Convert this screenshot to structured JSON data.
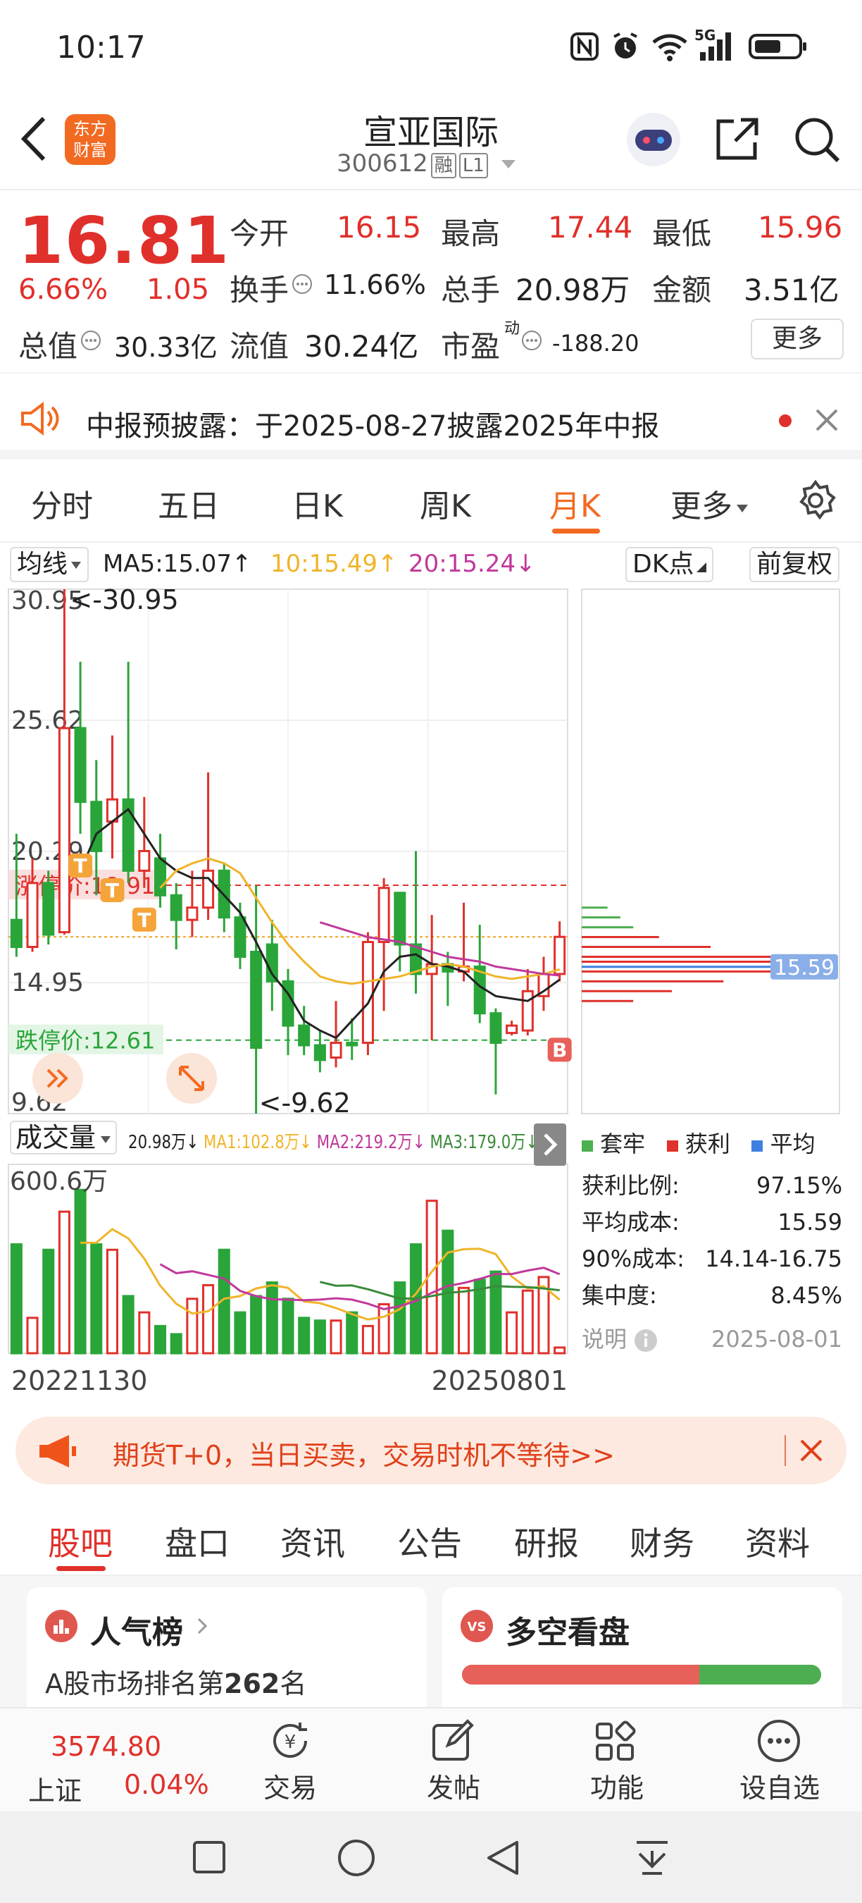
{
  "status_bar": {
    "time": "10:17",
    "network": "5G"
  },
  "header": {
    "title": "宣亚国际",
    "code": "300612",
    "tag_rong": "融",
    "tag_level": "L1",
    "logo_text": "东方\n财富",
    "icons": [
      "back-icon",
      "robot-icon",
      "share-icon",
      "search-icon"
    ]
  },
  "quote": {
    "price": "16.81",
    "change_pct": "6.66%",
    "change": "1.05",
    "open_label": "今开",
    "open": "16.15",
    "high_label": "最高",
    "high": "17.44",
    "low_label": "最低",
    "low": "15.96",
    "turnover_label": "换手",
    "turnover": "11.66%",
    "volume_label": "总手",
    "volume": "20.98万",
    "amount_label": "金额",
    "amount": "3.51亿",
    "mktcap_label": "总值",
    "mktcap": "30.33亿",
    "float_label": "流值",
    "float": "30.24亿",
    "pe_label": "市盈",
    "pe_sup": "动",
    "pe": "-188.20",
    "more_label": "更多"
  },
  "notice": {
    "text": "中报预披露：于2025-08-27披露2025年中报"
  },
  "tabs": {
    "items": [
      "分时",
      "五日",
      "日K",
      "周K",
      "月K",
      "更多"
    ],
    "active": "月K"
  },
  "ma_bar": {
    "select_label": "均线",
    "ma5": "MA5:15.07",
    "ma10": "10:15.49",
    "ma20": "20:15.24",
    "dk_label": "DK点",
    "adjust_label": "前复权"
  },
  "chart_data": {
    "type": "candlestick",
    "period": "monthly",
    "y_axis_labels": [
      "30.95",
      "25.62",
      "20.29",
      "14.95",
      "9.62"
    ],
    "ylim": [
      9.62,
      30.95
    ],
    "max_annotation": "<-30.95",
    "min_annotation": "<-9.62",
    "limit_up": {
      "label": "涨停价:18.91",
      "value": 18.91
    },
    "limit_down": {
      "label": "跌停价:12.61",
      "value": 12.61
    },
    "current_price_line": 16.81,
    "markers": [
      "T",
      "T",
      "T",
      "B"
    ],
    "candles": [
      {
        "o": 17.5,
        "c": 16.4,
        "h": 21.0,
        "l": 16.0
      },
      {
        "o": 16.4,
        "c": 19.0,
        "h": 20.0,
        "l": 16.2
      },
      {
        "o": 19.0,
        "c": 16.9,
        "h": 19.5,
        "l": 16.5
      },
      {
        "o": 17.0,
        "c": 25.3,
        "h": 30.95,
        "l": 16.9
      },
      {
        "o": 25.3,
        "c": 22.3,
        "h": 28.0,
        "l": 21.0
      },
      {
        "o": 22.3,
        "c": 20.3,
        "h": 24.0,
        "l": 18.5
      },
      {
        "o": 21.5,
        "c": 22.4,
        "h": 25.0,
        "l": 20.0
      },
      {
        "o": 22.4,
        "c": 19.5,
        "h": 28.0,
        "l": 19.0
      },
      {
        "o": 19.5,
        "c": 20.3,
        "h": 22.5,
        "l": 18.8
      },
      {
        "o": 20.0,
        "c": 18.5,
        "h": 21.0,
        "l": 18.0
      },
      {
        "o": 18.5,
        "c": 17.5,
        "h": 19.0,
        "l": 16.3
      },
      {
        "o": 17.5,
        "c": 18.0,
        "h": 19.5,
        "l": 16.8
      },
      {
        "o": 18.0,
        "c": 19.5,
        "h": 23.5,
        "l": 17.5
      },
      {
        "o": 19.5,
        "c": 17.6,
        "h": 19.8,
        "l": 17.0
      },
      {
        "o": 17.6,
        "c": 16.0,
        "h": 18.2,
        "l": 15.5
      },
      {
        "o": 16.2,
        "c": 12.3,
        "h": 18.9,
        "l": 9.62
      },
      {
        "o": 16.5,
        "c": 15.0,
        "h": 17.5,
        "l": 13.8
      },
      {
        "o": 15.0,
        "c": 13.2,
        "h": 15.5,
        "l": 12.0
      },
      {
        "o": 13.2,
        "c": 12.4,
        "h": 14.0,
        "l": 12.0
      },
      {
        "o": 12.4,
        "c": 11.8,
        "h": 13.0,
        "l": 11.3
      },
      {
        "o": 11.9,
        "c": 12.5,
        "h": 14.2,
        "l": 11.5
      },
      {
        "o": 12.5,
        "c": 12.4,
        "h": 13.5,
        "l": 11.8
      },
      {
        "o": 12.5,
        "c": 16.6,
        "h": 17.0,
        "l": 12.0
      },
      {
        "o": 16.6,
        "c": 18.8,
        "h": 19.2,
        "l": 13.8
      },
      {
        "o": 18.6,
        "c": 16.5,
        "h": 18.6,
        "l": 15.4
      },
      {
        "o": 16.5,
        "c": 15.3,
        "h": 20.3,
        "l": 14.5
      },
      {
        "o": 15.3,
        "c": 15.7,
        "h": 17.7,
        "l": 12.6
      },
      {
        "o": 15.7,
        "c": 15.4,
        "h": 16.2,
        "l": 14.0
      },
      {
        "o": 15.4,
        "c": 15.6,
        "h": 18.2,
        "l": 15.0
      },
      {
        "o": 15.6,
        "c": 13.7,
        "h": 17.3,
        "l": 13.3
      },
      {
        "o": 13.7,
        "c": 12.5,
        "h": 13.9,
        "l": 10.4
      },
      {
        "o": 12.9,
        "c": 13.2,
        "h": 13.4,
        "l": 12.8
      },
      {
        "o": 13.0,
        "c": 14.6,
        "h": 15.5,
        "l": 12.8
      },
      {
        "o": 14.4,
        "c": 15.3,
        "h": 16.0,
        "l": 13.8
      },
      {
        "o": 15.3,
        "c": 16.81,
        "h": 17.44,
        "l": 15.0
      }
    ],
    "ma_lines": [
      {
        "name": "MA5",
        "color": "#222222",
        "values": [
          null,
          null,
          null,
          null,
          19.5,
          21.0,
          21.5,
          22.0,
          21.0,
          20.0,
          19.5,
          19.2,
          19.2,
          18.5,
          17.8,
          16.6,
          15.3,
          14.5,
          13.4,
          13.0,
          12.7,
          13.4,
          14.1,
          15.4,
          16.0,
          16.1,
          15.7,
          15.6,
          15.4,
          14.8,
          14.4,
          14.3,
          14.2,
          14.6,
          15.07
        ]
      },
      {
        "name": "MA10",
        "color": "#f0b429",
        "values": [
          null,
          null,
          null,
          null,
          null,
          null,
          null,
          null,
          null,
          18.8,
          19.5,
          19.8,
          20.0,
          19.8,
          19.4,
          18.4,
          17.4,
          16.5,
          15.8,
          15.2,
          15.0,
          14.9,
          15.0,
          15.1,
          15.2,
          15.4,
          15.6,
          15.7,
          15.6,
          15.4,
          15.2,
          15.1,
          15.2,
          15.3,
          15.49
        ]
      },
      {
        "name": "MA20",
        "color": "#c0399a",
        "values": [
          null,
          null,
          null,
          null,
          null,
          null,
          null,
          null,
          null,
          null,
          null,
          null,
          null,
          null,
          null,
          null,
          null,
          null,
          null,
          17.4,
          17.2,
          17.0,
          16.8,
          16.7,
          16.6,
          16.4,
          16.2,
          16.0,
          15.9,
          15.8,
          15.6,
          15.5,
          15.4,
          15.3,
          15.24
        ]
      }
    ],
    "volume": {
      "label": "成交量",
      "current": "20.98万",
      "ma1": "MA1:102.8万",
      "ma2": "MA2:219.2万",
      "ma3": "MA3:179.0万",
      "max_label": "600.6万",
      "max_value": 600.6,
      "values": [
        400,
        130,
        380,
        520,
        600,
        400,
        380,
        210,
        150,
        100,
        70,
        200,
        250,
        380,
        150,
        210,
        260,
        200,
        130,
        120,
        120,
        150,
        100,
        180,
        260,
        400,
        560,
        450,
        240,
        270,
        300,
        150,
        230,
        280,
        20.98
      ]
    },
    "x_labels": [
      "20221130",
      "20250801"
    ],
    "cost_distribution": {
      "legend": [
        "套牢",
        "获利",
        "平均"
      ],
      "avg_label": "15.59",
      "rows": [
        {
          "label": "获利比例:",
          "value": "97.15%"
        },
        {
          "label": "平均成本:",
          "value": "15.59"
        },
        {
          "label": "90%成本:",
          "value": "14.14-16.75"
        },
        {
          "label": "集中度:",
          "value": "8.45%"
        }
      ],
      "note_label": "说明",
      "date": "2025-08-01",
      "bars": [
        {
          "price": 18.0,
          "len": 0.1,
          "type": "green"
        },
        {
          "price": 17.6,
          "len": 0.15,
          "type": "green"
        },
        {
          "price": 17.2,
          "len": 0.2,
          "type": "green"
        },
        {
          "price": 16.8,
          "len": 0.3,
          "type": "red"
        },
        {
          "price": 16.4,
          "len": 0.5,
          "type": "red"
        },
        {
          "price": 16.0,
          "len": 0.75,
          "type": "red"
        },
        {
          "price": 15.8,
          "len": 0.9,
          "type": "red"
        },
        {
          "price": 15.59,
          "len": 0.95,
          "type": "blue"
        },
        {
          "price": 15.4,
          "len": 0.8,
          "type": "red"
        },
        {
          "price": 15.0,
          "len": 0.55,
          "type": "red"
        },
        {
          "price": 14.6,
          "len": 0.35,
          "type": "red"
        },
        {
          "price": 14.2,
          "len": 0.2,
          "type": "red"
        }
      ]
    }
  },
  "banner": {
    "text": "期货T+0，当日买卖，交易时机不等待>>"
  },
  "bottom_tabs": {
    "items": [
      "股吧",
      "盘口",
      "资讯",
      "公告",
      "研报",
      "财务",
      "资料"
    ],
    "active": "股吧"
  },
  "cards": {
    "left_title": "人气榜",
    "left_sub_prefix": "A股市场排名第",
    "left_rank": "262",
    "left_sub_suffix": "名",
    "right_title": "多空看盘",
    "right_bull_ratio": 0.66
  },
  "tab_bar": {
    "index_name": "上证",
    "index_value": "3574.80",
    "index_change": "0.04%",
    "items": [
      "交易",
      "发帖",
      "功能",
      "设自选"
    ]
  }
}
